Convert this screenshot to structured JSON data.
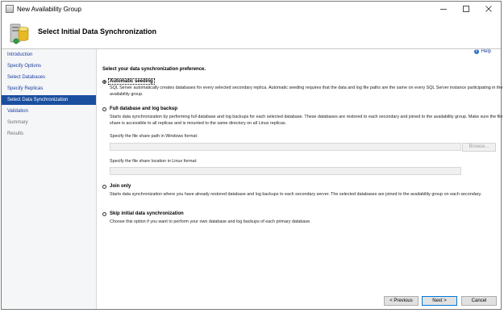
{
  "window": {
    "title": "New Availability Group"
  },
  "header": {
    "title": "Select Initial Data Synchronization"
  },
  "nav": {
    "items": [
      {
        "label": "Introduction",
        "state": "link"
      },
      {
        "label": "Specify Options",
        "state": "link"
      },
      {
        "label": "Select Databases",
        "state": "link"
      },
      {
        "label": "Specify Replicas",
        "state": "link"
      },
      {
        "label": "Select Data Synchronization",
        "state": "selected"
      },
      {
        "label": "Validation",
        "state": "link"
      },
      {
        "label": "Summary",
        "state": "disabled"
      },
      {
        "label": "Results",
        "state": "disabled"
      }
    ]
  },
  "help": {
    "label": "Help",
    "icon": "help-icon"
  },
  "main": {
    "prompt": "Select your data synchronization preference.",
    "options": {
      "automatic": {
        "label": "Automatic seeding",
        "selected": true,
        "description": "SQL Server automatically creates databases for every selected secondary replica. Automatic seeding requires that the data and log file paths are the same on every SQL Server instance participating in the availability group."
      },
      "full": {
        "label": "Full database and log backup",
        "selected": false,
        "description": "Starts data synchronization by performing full database and log backups for each selected database. These databases are restored to each secondary and joined to the availability group. Make sure the file share is accessible to all replicas and is mounted to the same directory on all Linux replicas.",
        "windows_path_label": "Specify the file share path in Windows format:",
        "windows_path_value": "",
        "browse_label": "Browse...",
        "linux_path_label": "Specify the file share location in Linux format:",
        "linux_path_value": ""
      },
      "join": {
        "label": "Join only",
        "selected": false,
        "description": "Starts data synchronization where you have already restored database and log backups to each secondary server. The selected databases are joined to the availability group on each secondary."
      },
      "skip": {
        "label": "Skip initial data synchronization",
        "selected": false,
        "description": "Choose this option if you want to perform your own database and log backups of each primary database."
      }
    }
  },
  "footer": {
    "previous_label": "< Previous",
    "next_label": "Next >",
    "cancel_label": "Cancel"
  },
  "colors": {
    "nav_selected": "#1a4fa0",
    "link": "#1a3e9c",
    "nav_bg": "#f5f6f8"
  }
}
